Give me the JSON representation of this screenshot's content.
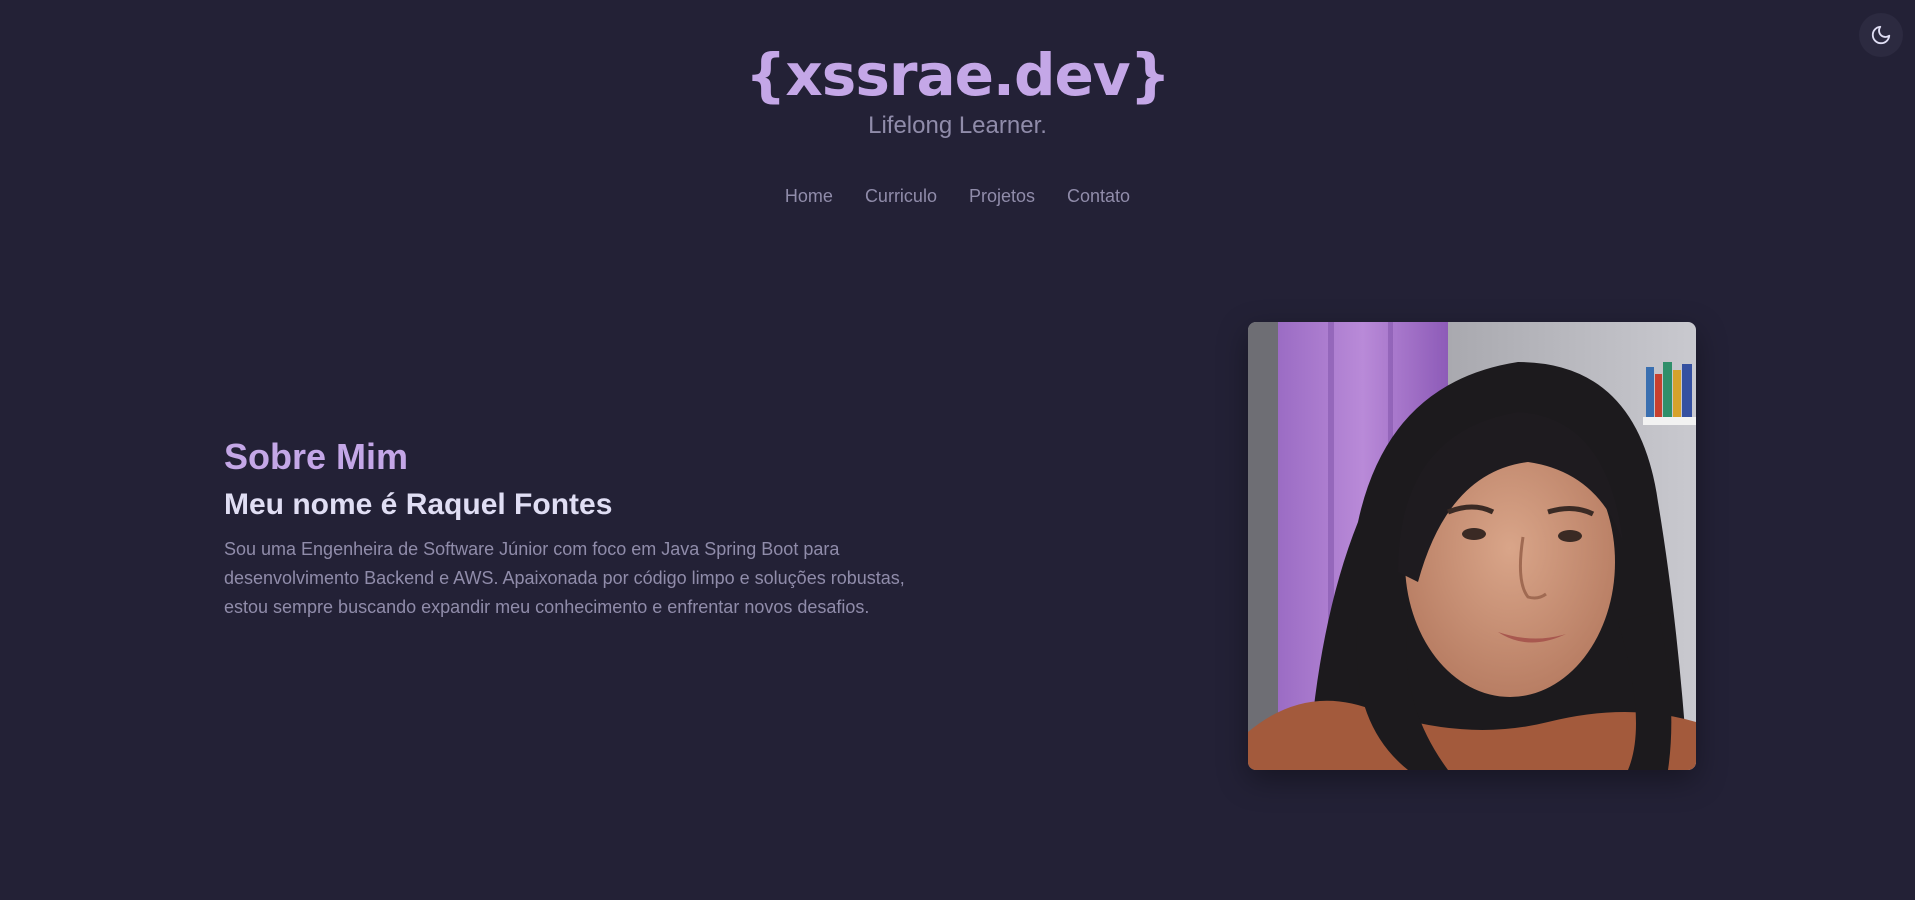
{
  "header": {
    "brand": "{xssrae.dev}",
    "tagline": "Lifelong Learner."
  },
  "nav": {
    "items": [
      "Home",
      "Curriculo",
      "Projetos",
      "Contato"
    ]
  },
  "theme_toggle": {
    "icon": "moon-icon"
  },
  "about": {
    "section_title": "Sobre Mim",
    "name_heading": "Meu nome é Raquel Fontes",
    "description": "Sou uma Engenheira de Software Júnior com foco em Java Spring Boot para desenvolvimento Backend e AWS. Apaixonada por código limpo e soluções robustas, estou sempre buscando expandir meu conhecimento e enfrentar novos desafios."
  },
  "colors": {
    "background": "#232136",
    "accent": "#c4a7e7",
    "text": "#e0def4",
    "muted": "#908caa"
  }
}
